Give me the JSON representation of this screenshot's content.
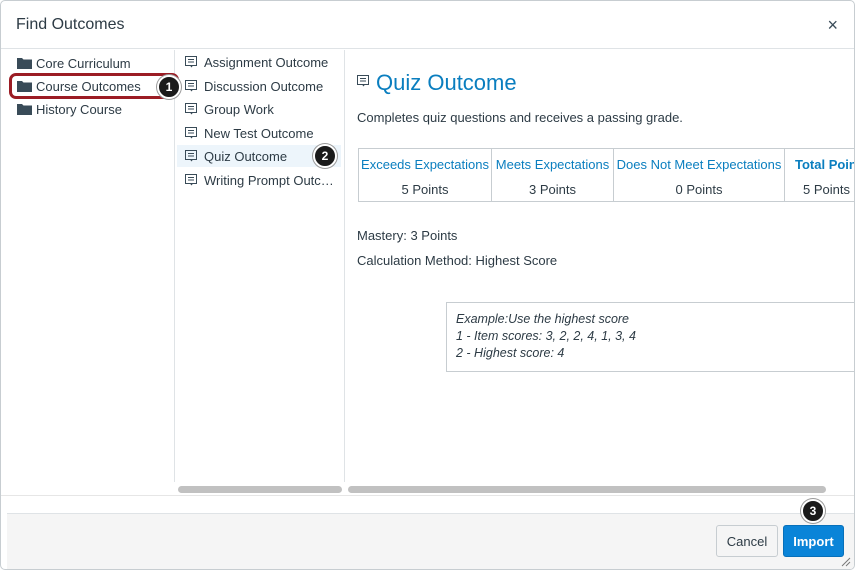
{
  "dialog": {
    "title": "Find Outcomes",
    "close_glyph": "×"
  },
  "groups": [
    {
      "label": "Core Curriculum",
      "icon": "folder-icon"
    },
    {
      "label": "Course Outcomes",
      "icon": "folder-icon",
      "highlighted": true
    },
    {
      "label": "History Course",
      "icon": "folder-icon"
    }
  ],
  "outcomes": [
    {
      "label": "Assignment Outcome",
      "icon": "outcome-icon"
    },
    {
      "label": "Discussion Outcome",
      "icon": "outcome-icon"
    },
    {
      "label": "Group Work",
      "icon": "outcome-icon"
    },
    {
      "label": "New Test Outcome",
      "icon": "outcome-icon"
    },
    {
      "label": "Quiz Outcome",
      "icon": "outcome-icon",
      "selected": true
    },
    {
      "label": "Writing Prompt Outco…",
      "icon": "outcome-icon"
    }
  ],
  "detail": {
    "title": "Quiz Outcome",
    "description": "Completes quiz questions and receives a passing grade.",
    "rubric": [
      {
        "header": "Exceeds Expectations",
        "value": "5 Points"
      },
      {
        "header": "Meets Expectations",
        "value": "3 Points"
      },
      {
        "header": "Does Not Meet Expectations",
        "value": "0 Points"
      },
      {
        "header": "Total Point",
        "value": "5 Points"
      }
    ],
    "mastery": "Mastery: 3 Points",
    "calculation": "Calculation Method: Highest Score",
    "example": {
      "line1": "Example:Use the highest score",
      "line2": "1 - Item scores: 3, 2, 2, 4, 1, 3, 4",
      "line3": "2 - Highest score: 4"
    }
  },
  "callouts": [
    "1",
    "2",
    "3"
  ],
  "footer": {
    "cancel_label": "Cancel",
    "import_label": "Import"
  },
  "colors": {
    "accent": "#0a7ebf",
    "primary_button": "#0a84d8",
    "highlight_border": "#9b1c24",
    "selected_row": "#edf5fb"
  }
}
